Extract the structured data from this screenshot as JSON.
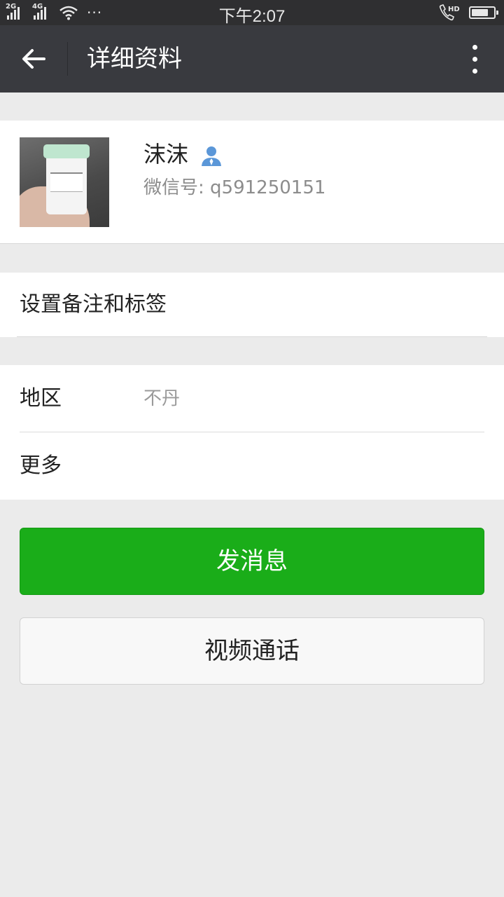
{
  "status_bar": {
    "network_1": "2G",
    "network_2": "4G",
    "more_dots": "···",
    "time": "下午2:07",
    "hd_label": "HD",
    "battery_level": 0.75
  },
  "header": {
    "title": "详细资料"
  },
  "profile": {
    "name": "沫沫",
    "wechat_id": "微信号: q591250151"
  },
  "remarks": {
    "label": "设置备注和标签"
  },
  "details": {
    "region_label": "地区",
    "region_value": "不丹",
    "more_label": "更多"
  },
  "actions": {
    "send_message": "发消息",
    "video_call": "视频通话"
  },
  "colors": {
    "primary_green": "#1aad19",
    "titlebar": "#393a3f",
    "statusbar": "#2f2f31",
    "contact_icon": "#5b97d8"
  }
}
